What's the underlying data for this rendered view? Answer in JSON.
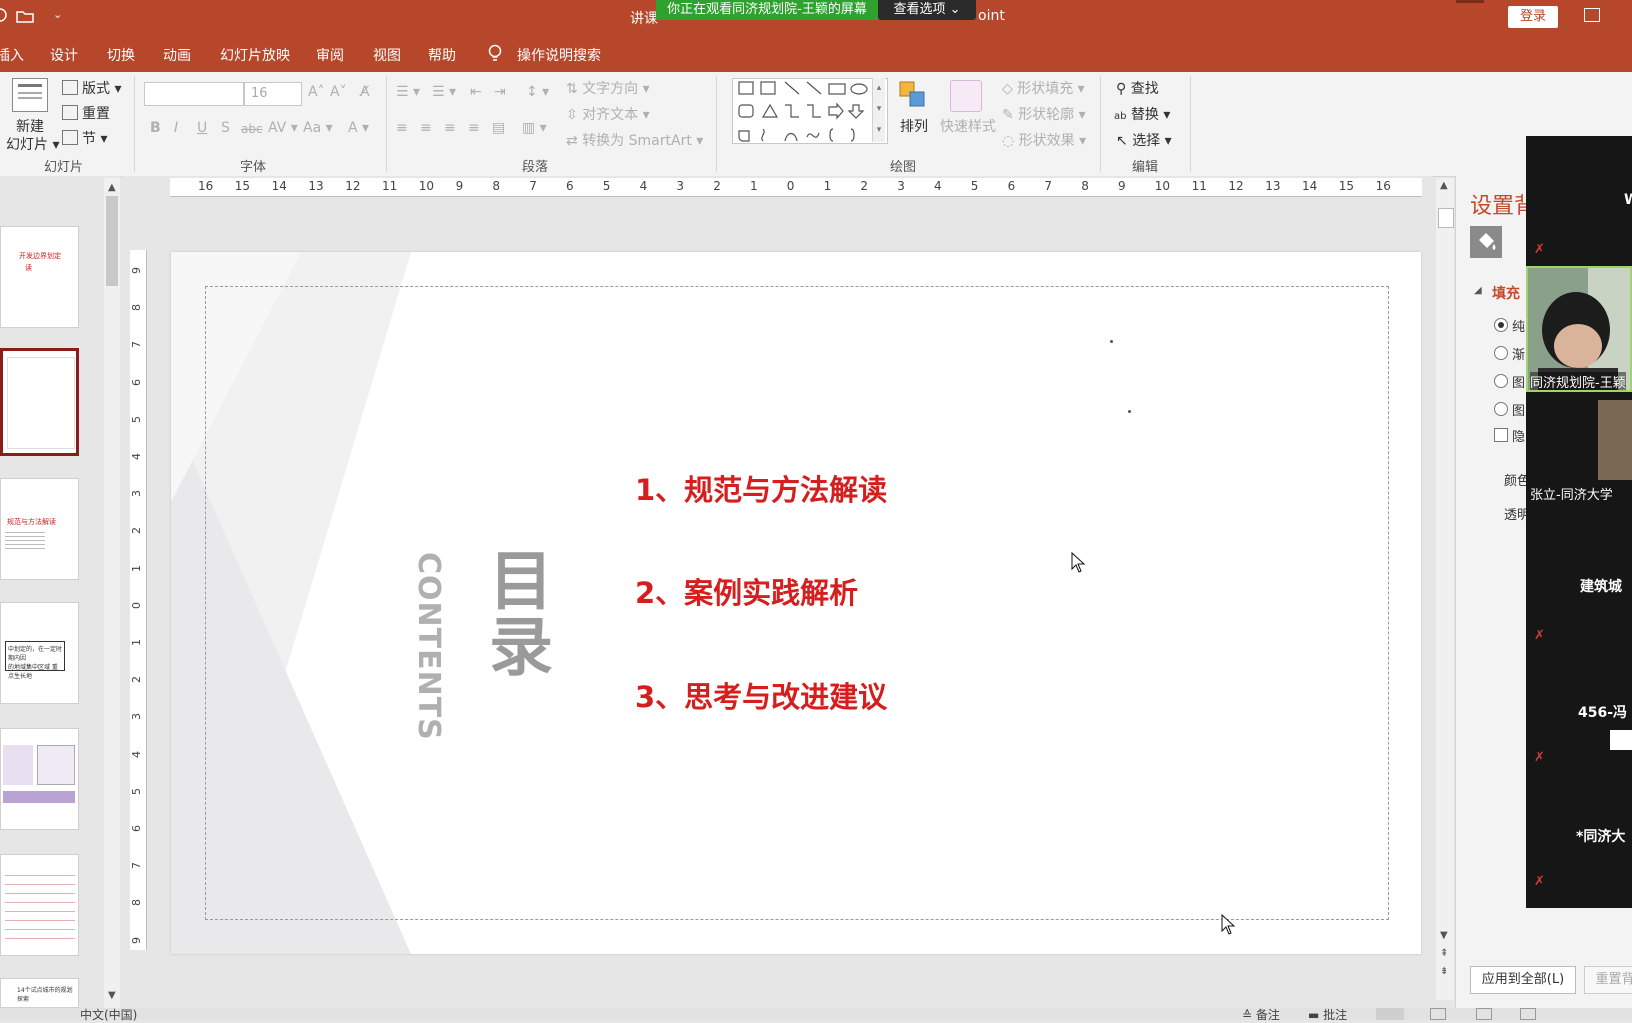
{
  "window": {
    "title": "讲课",
    "title_suffix": "oint",
    "share_banner": "你正在观看同济规划院-王颖的屏幕",
    "view_options": "查看选项",
    "login": "登录"
  },
  "tabs": [
    "插入",
    "设计",
    "切换",
    "动画",
    "幻灯片放映",
    "审阅",
    "视图",
    "帮助"
  ],
  "tell_me": "操作说明搜索",
  "ribbon": {
    "slides": {
      "new_slide": "新建",
      "new_slide2": "幻灯片",
      "layout": "版式",
      "reset": "重置",
      "section": "节",
      "label": "幻灯片"
    },
    "font": {
      "size": "16",
      "label": "字体"
    },
    "paragraph": {
      "text_direction": "文字方向",
      "align_text": "对齐文本",
      "smartart": "转换为 SmartArt",
      "label": "段落"
    },
    "drawing": {
      "arrange": "排列",
      "quick_styles": "快速样式",
      "shape_fill": "形状填充",
      "shape_outline": "形状轮廓",
      "shape_effects": "形状效果",
      "label": "绘图"
    },
    "editing": {
      "find": "查找",
      "replace": "替换",
      "select": "选择",
      "label": "编辑"
    }
  },
  "ruler_h": [
    "16",
    "15",
    "14",
    "13",
    "12",
    "11",
    "10",
    "9",
    "8",
    "7",
    "6",
    "5",
    "4",
    "3",
    "2",
    "1",
    "0",
    "1",
    "2",
    "3",
    "4",
    "5",
    "6",
    "7",
    "8",
    "9",
    "10",
    "11",
    "12",
    "13",
    "14",
    "15",
    "16"
  ],
  "ruler_v": [
    "9",
    "8",
    "7",
    "6",
    "5",
    "4",
    "3",
    "2",
    "1",
    "0",
    "1",
    "2",
    "3",
    "4",
    "5",
    "6",
    "7",
    "8",
    "9"
  ],
  "slide": {
    "toc_title": "目录",
    "toc_contents": "CONTENTS",
    "items": [
      "1、规范与方法解读",
      "2、案例实践解析",
      "3、思考与改进建议"
    ]
  },
  "thumbnails": {
    "t1_line1": "开发边界划定",
    "t1_line2": "读",
    "t3_line1": "规范与方法解读",
    "t4_line1": "中划定的，在一定时期内因",
    "t4_line2": "的地域集中区域 重点生长地",
    "t7_line1": "14个试点城市的规划探索"
  },
  "format_pane": {
    "title": "设置背",
    "fill_section": "填充",
    "options": [
      "纯",
      "渐",
      "图",
      "图",
      "隐"
    ],
    "color_label": "颜色",
    "transparency_label": "透明",
    "apply_all": "应用到全部(L)",
    "reset_bg": "重置背"
  },
  "video_tiles": [
    {
      "name": "W"
    },
    {
      "name": "同济规划院-王颖"
    },
    {
      "name": "张立-同济大学"
    },
    {
      "name": "建筑城"
    },
    {
      "name": "456-冯"
    },
    {
      "name": "*同济大"
    }
  ],
  "status": {
    "language": "中文(中国)",
    "notes": "备注",
    "comments": "批注"
  },
  "colors": {
    "accent": "#b7472a",
    "toc_red": "#d61e1e",
    "share_green": "#2ea12e"
  }
}
